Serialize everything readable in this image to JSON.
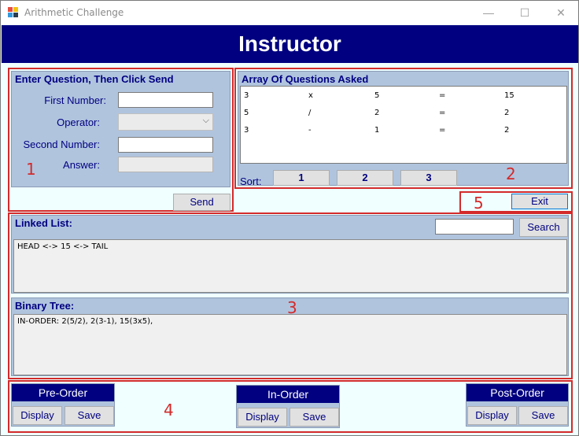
{
  "window": {
    "title": "Arithmetic Challenge",
    "minimize": "—",
    "maximize": "☐",
    "close": "✕"
  },
  "header": {
    "title": "Instructor"
  },
  "question_panel": {
    "title": "Enter Question, Then Click Send",
    "first_label": "First Number:",
    "operator_label": "Operator:",
    "second_label": "Second Number:",
    "answer_label": "Answer:",
    "first_value": "",
    "operator_value": "",
    "second_value": "",
    "answer_value": "",
    "send_label": "Send"
  },
  "array_panel": {
    "title": "Array Of Questions Asked",
    "rows": [
      [
        "3",
        "x",
        "5",
        "=",
        "15"
      ],
      [
        "5",
        "/",
        "2",
        "=",
        "2"
      ],
      [
        "3",
        "-",
        "1",
        "=",
        "2"
      ]
    ],
    "sort_label": "Sort:",
    "sort_buttons": [
      "1",
      "2",
      "3"
    ]
  },
  "exit_label": "Exit",
  "linked_list": {
    "title": "Linked List:",
    "search_value": "",
    "search_label": "Search",
    "content": "HEAD <-> 15 <-> TAIL"
  },
  "binary_tree": {
    "title": "Binary Tree:",
    "content": "IN-ORDER: 2(5/2), 2(3-1), 15(3x5),"
  },
  "orders": {
    "pre": {
      "title": "Pre-Order",
      "display": "Display",
      "save": "Save"
    },
    "in": {
      "title": "In-Order",
      "display": "Display",
      "save": "Save"
    },
    "post": {
      "title": "Post-Order",
      "display": "Display",
      "save": "Save"
    }
  },
  "annotations": [
    "1",
    "2",
    "3",
    "4",
    "5"
  ],
  "colors": {
    "navy": "#000080",
    "panel": "#b0c4de",
    "red": "#d42a2a",
    "background": "#f0ffff"
  }
}
